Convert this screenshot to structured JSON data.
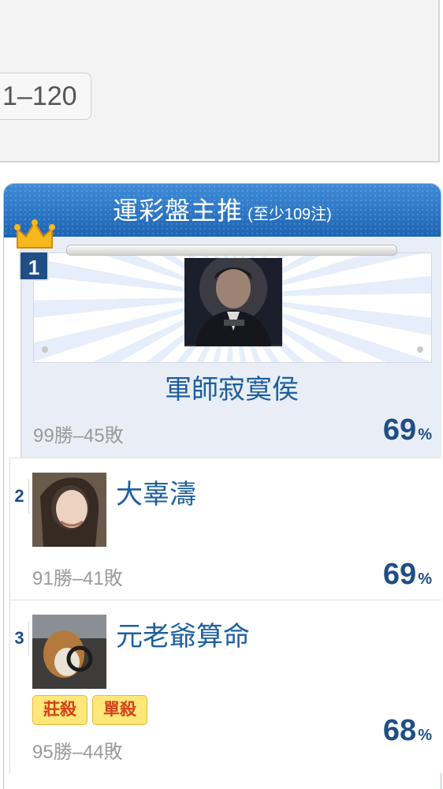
{
  "pagination": {
    "current_range": "1–120"
  },
  "ranking": {
    "header_title": "運彩盤主推",
    "header_sub": "(至少109注)",
    "entries": [
      {
        "rank": "1",
        "name": "軍師寂寞侯",
        "record": "99勝–45敗",
        "pct": "69",
        "pct_sign": "%"
      },
      {
        "rank": "2",
        "name": "大辜濤",
        "record": "91勝–41敗",
        "pct": "69",
        "pct_sign": "%"
      },
      {
        "rank": "3",
        "name": "元老爺算命",
        "record": "95勝–44敗",
        "pct": "68",
        "pct_sign": "%",
        "tags": [
          "莊殺",
          "單殺"
        ]
      }
    ]
  },
  "colors": {
    "header_blue": "#2b73c2",
    "name_blue": "#1d5fa0",
    "tag_yellow": "#ffe77a",
    "tag_text": "#d1411b"
  },
  "icons": {
    "crown": "crown-icon"
  }
}
